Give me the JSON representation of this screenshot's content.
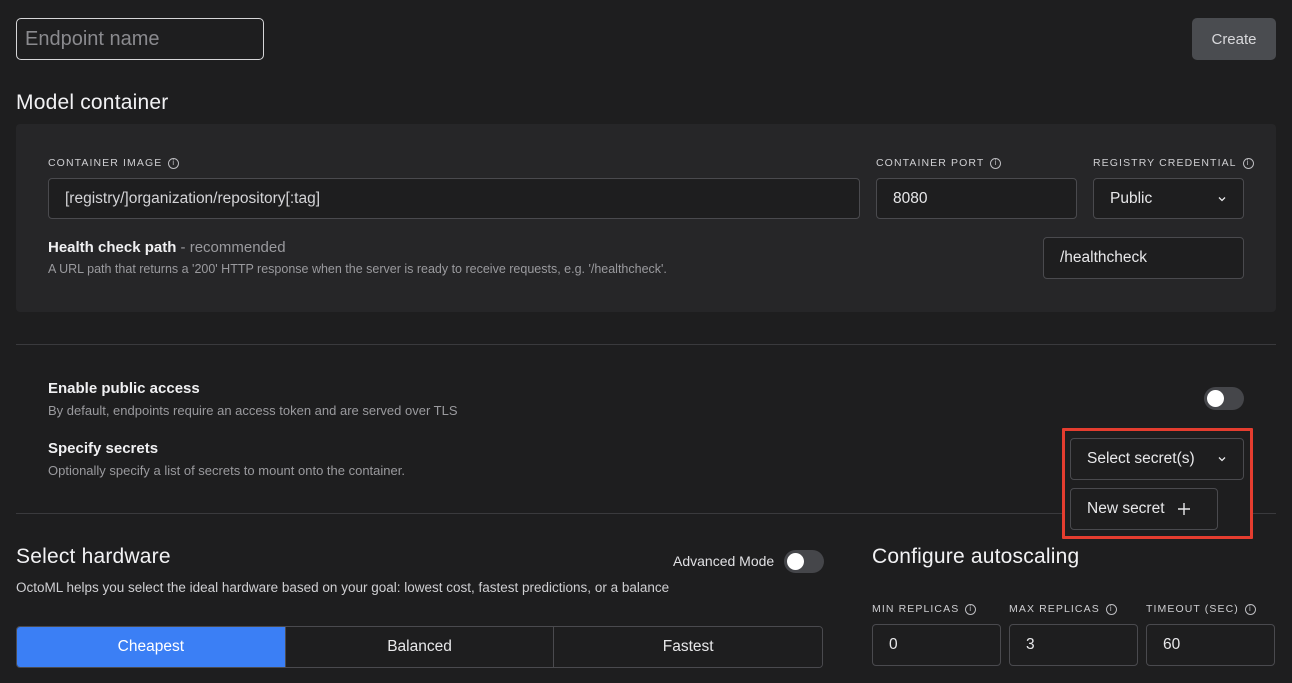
{
  "header": {
    "endpoint_placeholder": "Endpoint name",
    "create_label": "Create"
  },
  "model_container": {
    "title": "Model container",
    "container_image": {
      "label": "CONTAINER IMAGE",
      "placeholder": "[registry/]organization/repository[:tag]"
    },
    "container_port": {
      "label": "CONTAINER PORT",
      "value": "8080"
    },
    "registry_credential": {
      "label": "REGISTRY CREDENTIAL",
      "value": "Public"
    },
    "health_check": {
      "title": "Health check path",
      "suffix": " - recommended",
      "description": "A URL path that returns a '200' HTTP response when the server is ready to receive requests, e.g. '/healthcheck'.",
      "placeholder": "/healthcheck"
    }
  },
  "public_access": {
    "title": "Enable public access",
    "description": "By default, endpoints require an access token and are served over TLS",
    "enabled": false
  },
  "secrets": {
    "title": "Specify secrets",
    "description": "Optionally specify a list of secrets to mount onto the container.",
    "select_label": "Select secret(s)",
    "new_secret_label": "New secret",
    "highlight_color": "#e53d2f"
  },
  "hardware": {
    "title": "Select hardware",
    "advanced_mode_label": "Advanced Mode",
    "advanced_mode_enabled": false,
    "description": "OctoML helps you select the ideal hardware based on your goal: lowest cost, fastest predictions, or a balance",
    "options": [
      "Cheapest",
      "Balanced",
      "Fastest"
    ],
    "selected": "Cheapest",
    "accent_color": "#3b7ff5"
  },
  "autoscaling": {
    "title": "Configure autoscaling",
    "min_replicas": {
      "label": "MIN REPLICAS",
      "value": "0"
    },
    "max_replicas": {
      "label": "MAX REPLICAS",
      "value": "3"
    },
    "timeout": {
      "label": "TIMEOUT (SEC)",
      "value": "60"
    }
  }
}
